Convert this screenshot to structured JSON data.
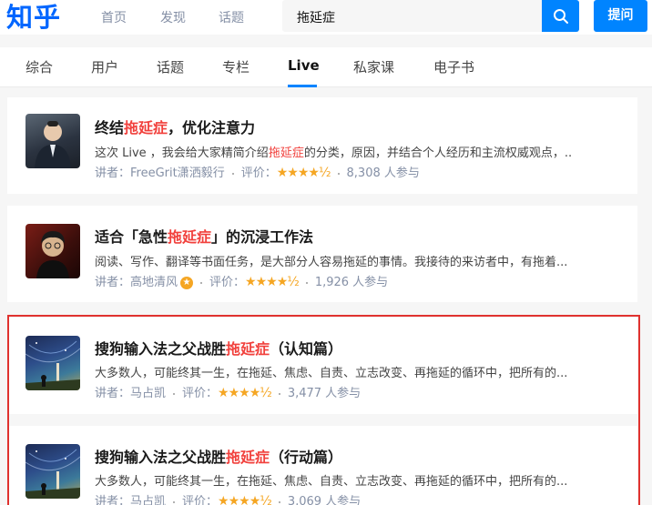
{
  "header": {
    "logo": "知乎",
    "nav": [
      "首页",
      "发现",
      "话题"
    ],
    "search_value": "拖延症",
    "ask_label": "提问"
  },
  "tabs": [
    "综合",
    "用户",
    "话题",
    "专栏",
    "Live",
    "私家课",
    "电子书"
  ],
  "active_tab": "Live",
  "results": [
    {
      "title_pre": "终结",
      "title_hl": "拖延症",
      "title_post": "，优化注意力",
      "desc_pre": "这次 Live ，我会给大家精简介绍",
      "desc_hl": "拖延症",
      "desc_post": "的分类，原因，并结合个人经历和主流权威观点，..",
      "speaker_label": "讲者：",
      "speaker": "FreeGrit潇洒毅行",
      "rating_label": "评价：",
      "rating": 4.5,
      "stars": "★★★★½",
      "participants": "8,308 人参与"
    },
    {
      "title_pre": "适合「急性",
      "title_hl": "拖延症",
      "title_post": "」的沉浸工作法",
      "desc_pre": "阅读、写作、翻译等书面任务，是大部分人容易拖延的事情。我接待的来访者中，有拖着...",
      "desc_hl": "",
      "desc_post": "",
      "speaker_label": "讲者：",
      "speaker": "高地清风",
      "rating_label": "评价：",
      "rating": 4.5,
      "stars": "★★★★½",
      "participants": "1,926 人参与"
    },
    {
      "title_pre": "搜狗输入法之父战胜",
      "title_hl": "拖延症",
      "title_post": "（认知篇）",
      "desc_pre": "大多数人，可能终其一生，在拖延、焦虑、自责、立志改变、再拖延的循环中，把所有的...",
      "desc_hl": "",
      "desc_post": "",
      "speaker_label": "讲者：",
      "speaker": "马占凯",
      "rating_label": "评价：",
      "rating": 4.5,
      "stars": "★★★★½",
      "participants": "3,477 人参与"
    },
    {
      "title_pre": "搜狗输入法之父战胜",
      "title_hl": "拖延症",
      "title_post": "（行动篇）",
      "desc_pre": "大多数人，可能终其一生，在拖延、焦虑、自责、立志改变、再拖延的循环中，把所有的...",
      "desc_hl": "",
      "desc_post": "",
      "speaker_label": "讲者：",
      "speaker": "马占凯",
      "rating_label": "评价：",
      "rating": 4.5,
      "stars": "★★★★½",
      "participants": "3,069 人参与"
    }
  ],
  "colors": {
    "brand": "#0084ff",
    "highlight": "#f1403c",
    "frame": "#e0322f",
    "star": "#f5a623"
  }
}
